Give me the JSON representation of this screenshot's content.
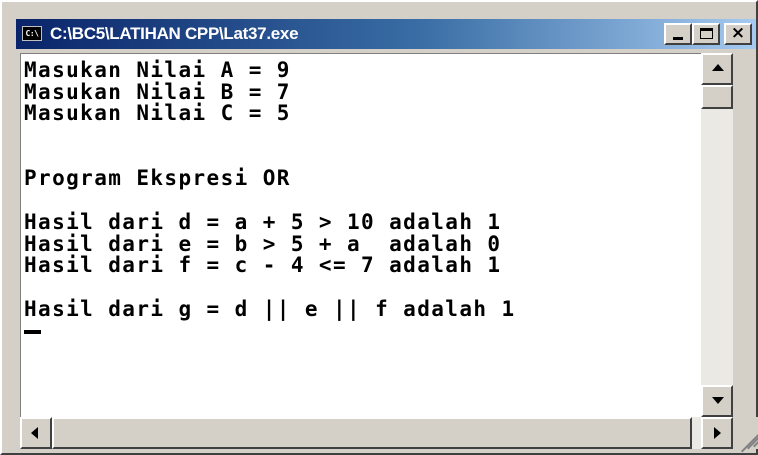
{
  "window": {
    "title": "C:\\BC5\\LATIHAN CPP\\Lat37.exe",
    "icon": "console-app-icon",
    "icon_text": "C:\\",
    "controls": {
      "minimize": "minimize-icon",
      "maximize": "maximize-icon",
      "close": "×"
    }
  },
  "console": {
    "lines": [
      "Masukan Nilai A = 9",
      "Masukan Nilai B = 7",
      "Masukan Nilai C = 5",
      "",
      "",
      "Program Ekspresi OR",
      "",
      "Hasil dari d = a + 5 > 10 adalah 1",
      "Hasil dari e = b > 5 + a  adalah 0",
      "Hasil dari f = c - 4 <= 7 adalah 1",
      "",
      "Hasil dari g = d || e || f adalah 1"
    ],
    "cursor": "_"
  },
  "colors": {
    "title_gradient_start": "#0a246a",
    "title_gradient_end": "#a6caf0",
    "chrome": "#d4d0c8",
    "console_bg": "#ffffff",
    "console_text": "#000000"
  }
}
